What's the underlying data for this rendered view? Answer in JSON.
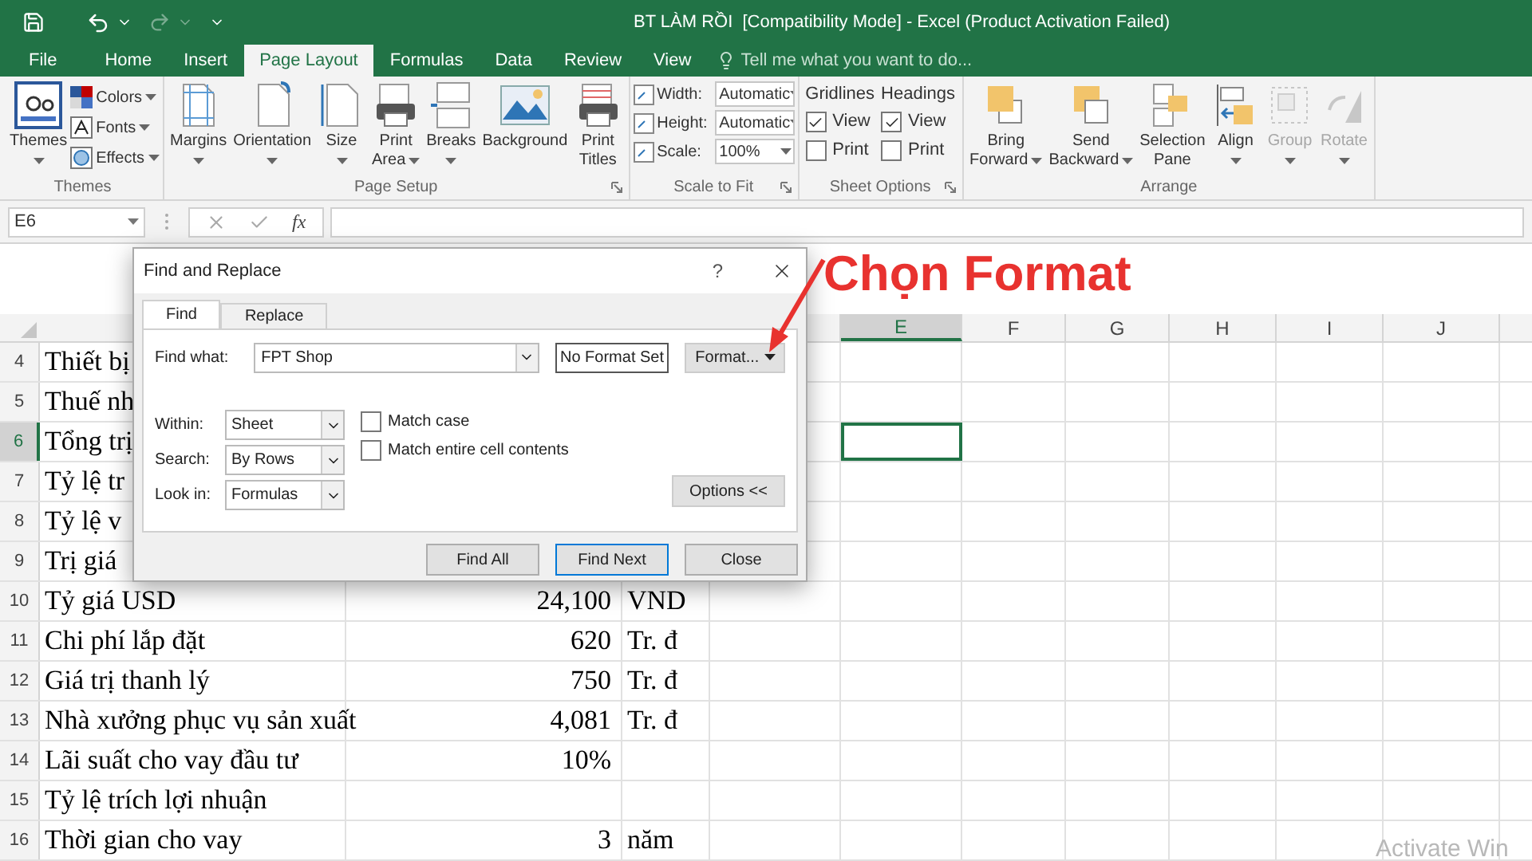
{
  "title_bar": {
    "title": "BT LÀM RỒI  [Compatibility Mode] - Excel (Product Activation Failed)"
  },
  "ribbon_tabs": [
    {
      "label": "File",
      "selected": false
    },
    {
      "label": "Home",
      "selected": false
    },
    {
      "label": "Insert",
      "selected": false
    },
    {
      "label": "Page Layout",
      "selected": true
    },
    {
      "label": "Formulas",
      "selected": false
    },
    {
      "label": "Data",
      "selected": false
    },
    {
      "label": "Review",
      "selected": false
    },
    {
      "label": "View",
      "selected": false
    }
  ],
  "tell_me": {
    "placeholder": "Tell me what you want to do..."
  },
  "ribbon_groups": [
    {
      "label": "Themes",
      "launcher": false,
      "commands": [
        {
          "kind": "large",
          "lines": [
            "Themes"
          ],
          "dropdown": true,
          "disabled": false
        },
        {
          "kind": "stack",
          "items": [
            {
              "label": "Colors",
              "dropdown": true
            },
            {
              "label": "Fonts",
              "dropdown": true
            },
            {
              "label": "Effects",
              "dropdown": true
            }
          ]
        }
      ]
    },
    {
      "label": "Page Setup",
      "launcher": true,
      "commands": [
        {
          "kind": "large",
          "lines": [
            "Margins"
          ],
          "dropdown": true,
          "disabled": false
        },
        {
          "kind": "large",
          "lines": [
            "Orientation"
          ],
          "dropdown": true,
          "disabled": false
        },
        {
          "kind": "large",
          "lines": [
            "Size"
          ],
          "dropdown": true,
          "disabled": false
        },
        {
          "kind": "large",
          "lines": [
            "Print",
            "Area"
          ],
          "dropdown": true,
          "disabled": false
        },
        {
          "kind": "large",
          "lines": [
            "Breaks"
          ],
          "dropdown": true,
          "disabled": false
        },
        {
          "kind": "large",
          "lines": [
            "Background"
          ],
          "dropdown": false,
          "disabled": false
        },
        {
          "kind": "large",
          "lines": [
            "Print",
            "Titles"
          ],
          "dropdown": false,
          "disabled": false
        }
      ]
    },
    {
      "label": "Scale to Fit",
      "launcher": true,
      "commands": [
        {
          "kind": "fields",
          "items": [
            {
              "label": "Width:",
              "value": "Automatic"
            },
            {
              "label": "Height:",
              "value": "Automatic"
            },
            {
              "label": "Scale:",
              "value": "100%"
            }
          ]
        }
      ]
    },
    {
      "label": "Sheet Options",
      "launcher": true,
      "commands": [
        {
          "kind": "checks",
          "heading": "Gridlines",
          "items": [
            {
              "label": "View",
              "checked": true
            },
            {
              "label": "Print",
              "checked": false
            }
          ]
        },
        {
          "kind": "checks",
          "heading": "Headings",
          "items": [
            {
              "label": "View",
              "checked": true
            },
            {
              "label": "Print",
              "checked": false
            }
          ]
        }
      ]
    },
    {
      "label": "Arrange",
      "launcher": false,
      "commands": [
        {
          "kind": "large",
          "lines": [
            "Bring",
            "Forward"
          ],
          "dropdown": true,
          "disabled": false
        },
        {
          "kind": "large",
          "lines": [
            "Send",
            "Backward"
          ],
          "dropdown": true,
          "disabled": false
        },
        {
          "kind": "large",
          "lines": [
            "Selection",
            "Pane"
          ],
          "dropdown": false,
          "disabled": false
        },
        {
          "kind": "large",
          "lines": [
            "Align"
          ],
          "dropdown": true,
          "disabled": false
        },
        {
          "kind": "large",
          "lines": [
            "Group"
          ],
          "dropdown": true,
          "disabled": true
        },
        {
          "kind": "large",
          "lines": [
            "Rotate"
          ],
          "dropdown": true,
          "disabled": true
        }
      ]
    }
  ],
  "formula_bar": {
    "name_box": "E6",
    "function_label": "fx"
  },
  "grid": {
    "columns": [
      {
        "label": "E",
        "selected": true
      },
      {
        "label": "F",
        "selected": false
      },
      {
        "label": "G",
        "selected": false
      },
      {
        "label": "H",
        "selected": false
      },
      {
        "label": "I",
        "selected": false
      },
      {
        "label": "J",
        "selected": false
      }
    ],
    "rows": [
      {
        "number": "4",
        "label": "Thiết bị",
        "value": "",
        "unit": "",
        "selected": false
      },
      {
        "number": "5",
        "label": "Thuế nh",
        "value": "",
        "unit": "",
        "selected": false
      },
      {
        "number": "6",
        "label": "Tổng trị",
        "value": "",
        "unit": "",
        "selected": true
      },
      {
        "number": "7",
        "label": "Tỷ lệ tr",
        "value": "",
        "unit": "",
        "selected": false
      },
      {
        "number": "8",
        "label": "Tỷ lệ v",
        "value": "",
        "unit": "",
        "selected": false
      },
      {
        "number": "9",
        "label": "Trị giá",
        "value": "",
        "unit": "",
        "selected": false
      },
      {
        "number": "10",
        "label": "Tỷ giá USD",
        "value": "24,100",
        "unit": "VND",
        "selected": false
      },
      {
        "number": "11",
        "label": "Chi phí lắp đặt",
        "value": "620",
        "unit": "Tr. đ",
        "selected": false
      },
      {
        "number": "12",
        "label": "Giá trị thanh lý",
        "value": "750",
        "unit": "Tr. đ",
        "selected": false
      },
      {
        "number": "13",
        "label": "Nhà xưởng phục vụ sản xuất",
        "value": "4,081",
        "unit": "Tr. đ",
        "selected": false
      },
      {
        "number": "14",
        "label": "Lãi suất cho vay đầu tư",
        "value": "10%",
        "unit": "",
        "selected": false
      },
      {
        "number": "15",
        "label": "Tỷ lệ trích lợi nhuận",
        "value": "",
        "unit": "",
        "selected": false
      },
      {
        "number": "16",
        "label": "Thời gian cho vay",
        "value": "3",
        "unit": "năm",
        "selected": false
      }
    ]
  },
  "dialog": {
    "title": "Find and Replace",
    "help": "?",
    "tabs": [
      {
        "label": "Find",
        "selected": true
      },
      {
        "label": "Replace",
        "selected": false
      }
    ],
    "find_what": {
      "label": "Find what:",
      "value": "FPT Shop"
    },
    "format_status": "No Format Set",
    "format_button": "Format...",
    "options": [
      {
        "label": "Within:",
        "value": "Sheet"
      },
      {
        "label": "Search:",
        "value": "By Rows"
      },
      {
        "label": "Look in:",
        "value": "Formulas"
      }
    ],
    "checkboxes": [
      {
        "label": "Match case",
        "checked": false
      },
      {
        "label": "Match entire cell contents",
        "checked": false
      }
    ],
    "options_button": "Options <<",
    "buttons": [
      {
        "label": "Find All",
        "default": false
      },
      {
        "label": "Find Next",
        "default": true
      },
      {
        "label": "Close",
        "default": false
      }
    ]
  },
  "annotation": {
    "text": "Chọn Format"
  },
  "activation_notice": "Activate Win"
}
